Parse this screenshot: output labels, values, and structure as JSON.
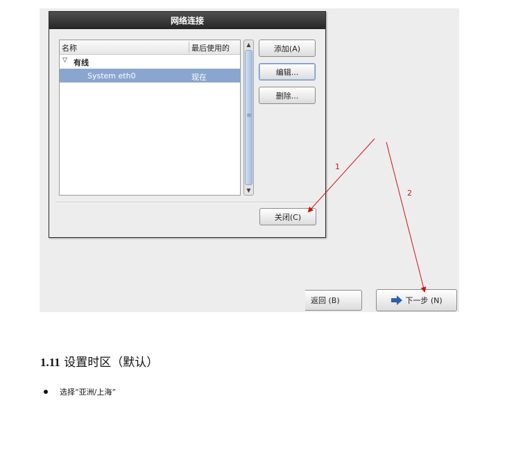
{
  "dialog": {
    "title": "网络连接",
    "list": {
      "col_name": "名称",
      "col_last_used": "最后使用的",
      "group": "有线",
      "group_toggle": "▽",
      "selected_row": {
        "name": "System eth0",
        "last_used": "现在"
      }
    },
    "buttons": {
      "add": "添加(A)",
      "edit": "编辑...",
      "delete": "删除...",
      "close": "关闭(C)"
    }
  },
  "annotations": {
    "label1": "1",
    "label2": "2"
  },
  "wizard": {
    "back": "返回 (B)",
    "next": "下一步 (N)"
  },
  "doc": {
    "section_number": "1.11",
    "section_title": "设置时区（默认）",
    "bullet": "选择“亚洲/上海”"
  },
  "colors": {
    "selection": "#8aa6cf",
    "arrow_red": "#d01010",
    "titlebar": "#333333"
  }
}
